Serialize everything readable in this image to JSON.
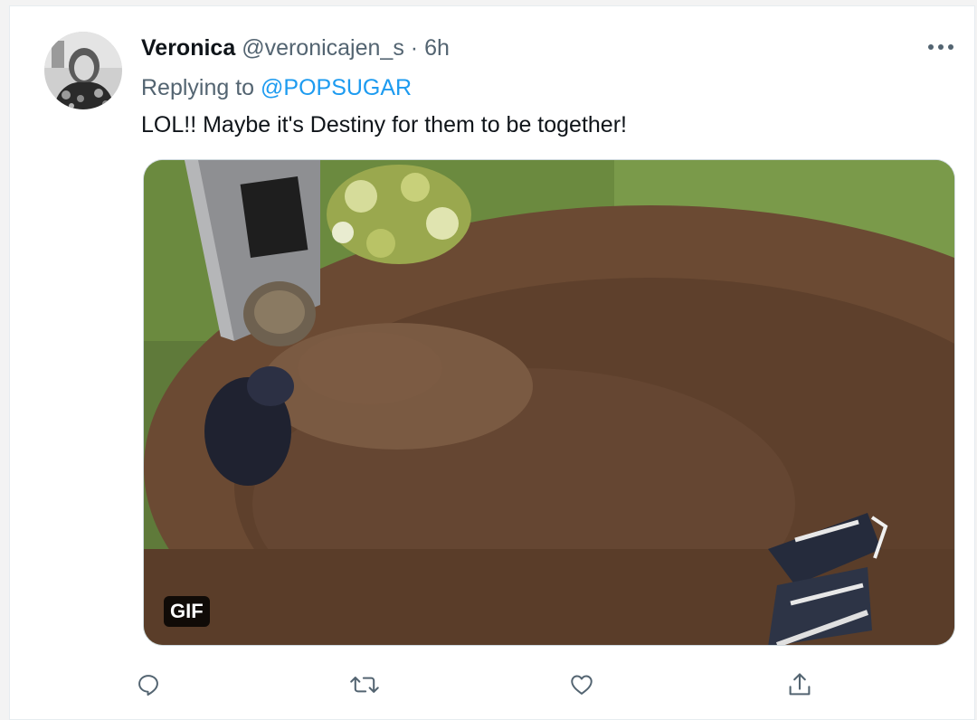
{
  "tweet": {
    "display_name": "Veronica",
    "handle": "@veronicajen_s",
    "separator": "·",
    "timestamp": "6h",
    "replying_prefix": "Replying to ",
    "replying_to": "@POPSUGAR",
    "text": "LOL!! Maybe it's Destiny for them to be together!"
  },
  "media": {
    "badge": "GIF"
  },
  "icons": {
    "more": "more-horizontal-icon",
    "reply": "reply-icon",
    "retweet": "retweet-icon",
    "like": "heart-icon",
    "share": "share-icon"
  },
  "colors": {
    "link": "#1d9bf0",
    "secondary_text": "#536471",
    "primary_text": "#0f1419",
    "icon": "#536471"
  }
}
